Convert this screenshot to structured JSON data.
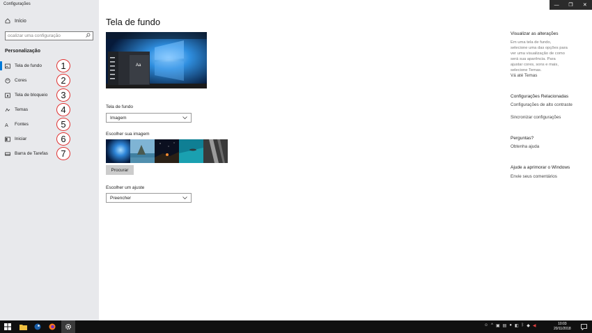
{
  "app": {
    "title": "Configurações"
  },
  "window_controls": {
    "minimize": "—",
    "maximize": "❐",
    "close": "✕"
  },
  "sidebar": {
    "home_label": "Início",
    "search_placeholder": "ocalizar uma configuração",
    "section_title": "Personalização",
    "items": [
      {
        "label": "Tela de fundo",
        "icon": "image-icon",
        "badge": "1",
        "active": true
      },
      {
        "label": "Cores",
        "icon": "palette-icon",
        "badge": "2"
      },
      {
        "label": "Tela de bloqueio",
        "icon": "lock-screen-icon",
        "badge": "3"
      },
      {
        "label": "Temas",
        "icon": "themes-icon",
        "badge": "4"
      },
      {
        "label": "Fontes",
        "icon": "font-icon",
        "badge": "5"
      },
      {
        "label": "Iniciar",
        "icon": "start-icon",
        "badge": "6"
      },
      {
        "label": "Barra de Tarefas",
        "icon": "taskbar-icon",
        "badge": "7"
      }
    ]
  },
  "main": {
    "title": "Tela de fundo",
    "preview_text": "Aa",
    "background_label": "Tela de fundo",
    "background_value": "Imagem",
    "choose_label": "Escolher sua imagem",
    "browse_button": "Procurar",
    "fit_label": "Escolher um ajuste",
    "fit_value": "Preencher"
  },
  "right_panel": {
    "preview_heading": "Visualizar as alterações",
    "preview_text": "Em uma tela de fundo, selecione uma das opções para ver uma visualização de como será sua aparência. Para ajustar cores, sons e mais, selecione Temas.",
    "themes_link": "Vá até Temas",
    "related_heading": "Configurações Relacionadas",
    "contrast_link": "Configurações de alto contraste",
    "sync_link": "Sincronizar configurações",
    "questions_heading": "Perguntas?",
    "help_link": "Obtenha ajuda",
    "improve_heading": "Ajude a aprimorar o Windows",
    "feedback_link": "Envie seus comentários"
  },
  "taskbar": {
    "clock_time": "10:03",
    "clock_date": "20/11/2018"
  },
  "colors": {
    "accent": "#0078d7",
    "sidebar_bg": "#e8e9ec",
    "badge_border": "#e03030"
  }
}
